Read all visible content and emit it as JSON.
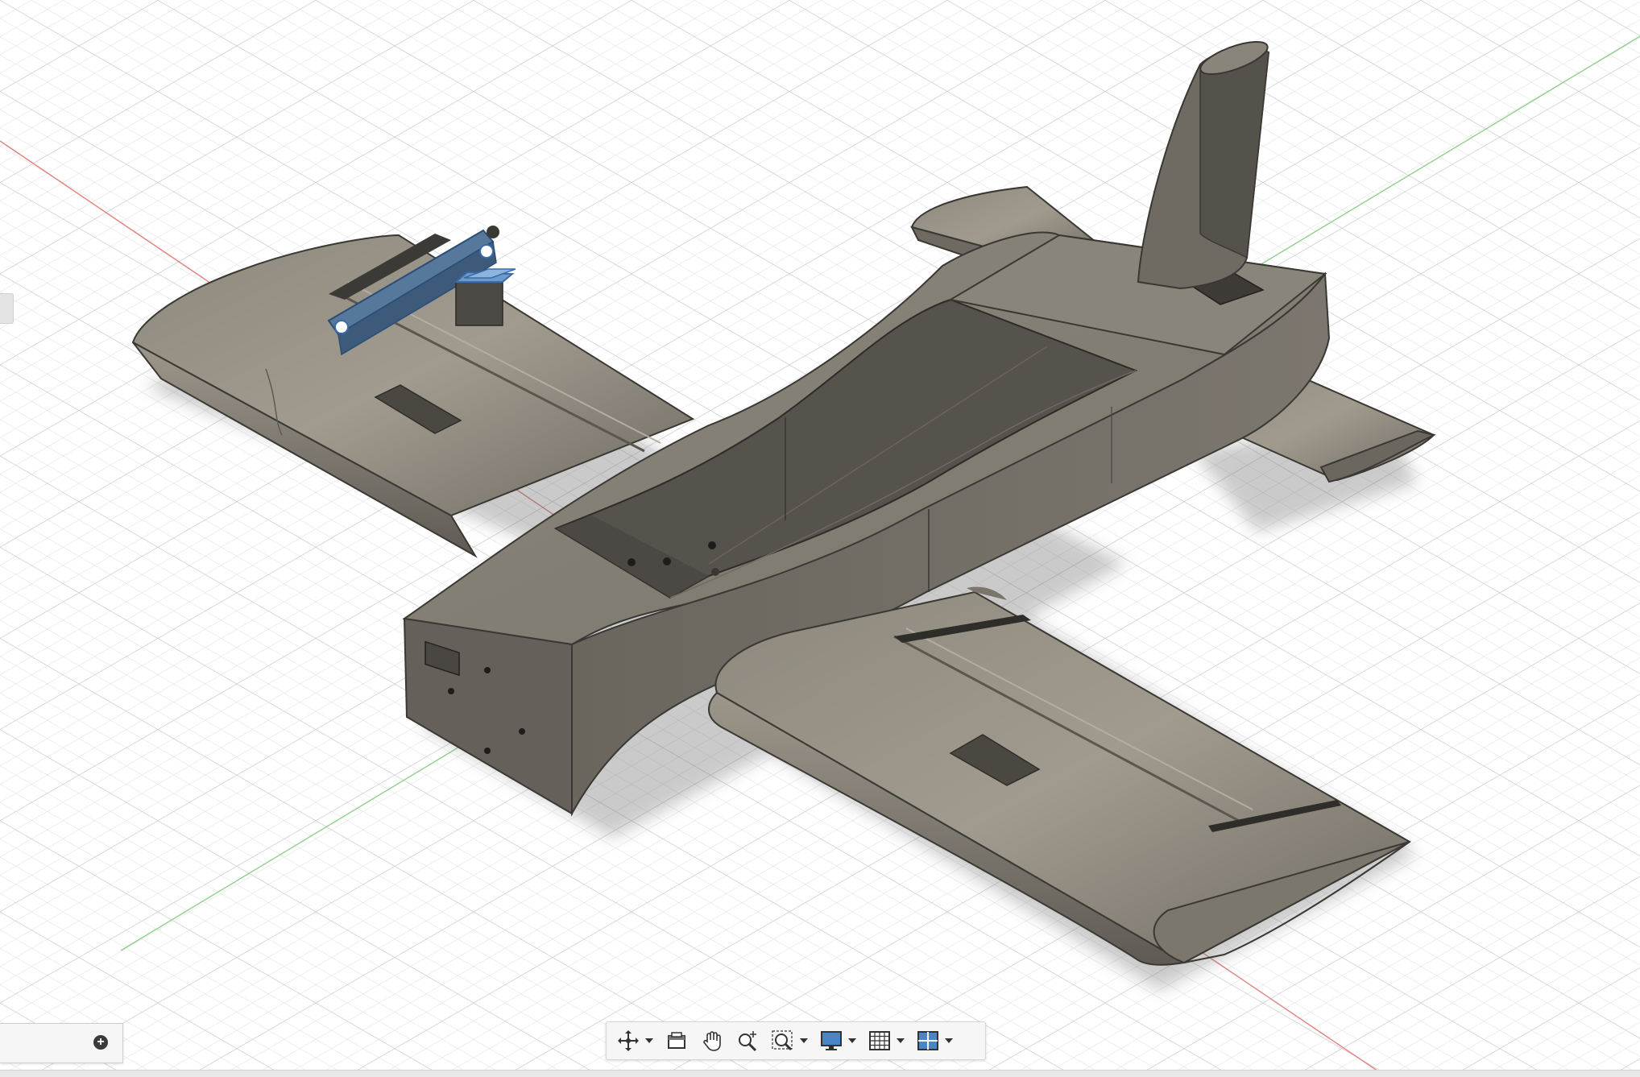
{
  "viewport": {
    "model": "rc-airplane-body",
    "background": "#ffffff",
    "grid_color": "#d9d9d9",
    "axis_colors": {
      "x": "#e06060",
      "y": "#78c878"
    },
    "model_color": "#7b776d"
  },
  "comment_panel": {
    "add_icon": "plus-circle-icon"
  },
  "nav_toolbar": {
    "tools": [
      {
        "name": "orbit",
        "icon": "orbit-icon",
        "has_dropdown": true
      },
      {
        "name": "look-at",
        "icon": "look-at-icon",
        "has_dropdown": false
      },
      {
        "name": "pan",
        "icon": "pan-hand-icon",
        "has_dropdown": false
      },
      {
        "name": "zoom",
        "icon": "zoom-icon",
        "has_dropdown": false
      },
      {
        "name": "fit",
        "icon": "zoom-window-icon",
        "has_dropdown": true
      },
      {
        "name": "display-settings",
        "icon": "display-monitor-icon",
        "has_dropdown": true
      },
      {
        "name": "grid-snaps",
        "icon": "grid-icon",
        "has_dropdown": true
      },
      {
        "name": "viewports",
        "icon": "viewports-icon",
        "has_dropdown": true
      }
    ]
  }
}
